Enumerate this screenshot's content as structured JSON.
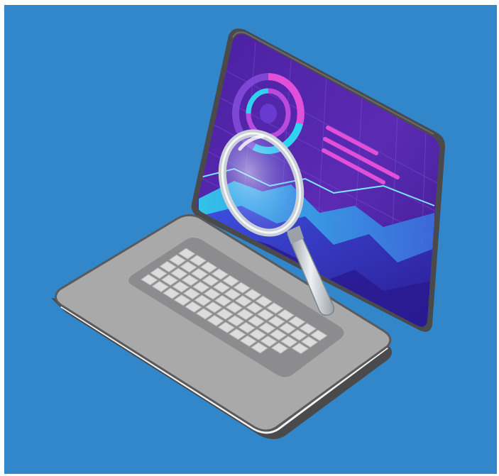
{
  "scene": {
    "subject": "laptop-with-magnifying-glass",
    "colors": {
      "page_background": "#ffffff",
      "backdrop_blue": "#3287ca",
      "laptop_frame_dark": "#4a4a4c",
      "deck_gray": "#a9a9a9",
      "deck_light_edge": "#f2f2f2",
      "keyboard_well": "#8c8c8e",
      "key_color": "#dcdcdc",
      "screen_violet": "#5b2bb3",
      "screen_deep": "#3a1a8a",
      "screen_cyan": "#2fd3f0",
      "screen_magenta": "#e24fd8",
      "magnifier_rim": "#c9cfd6",
      "magnifier_handle": "#d8dde3"
    },
    "icons": [
      "laptop-icon",
      "magnifying-glass-icon",
      "donut-chart-icon",
      "line-chart-icon"
    ]
  }
}
